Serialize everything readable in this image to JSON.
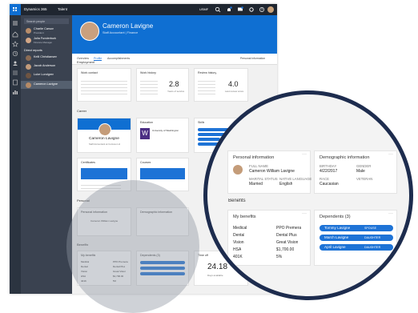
{
  "app": {
    "brand": "Dynamics 365",
    "module": "Talent",
    "company": "USMF",
    "topbar_icons": [
      "search-icon",
      "bell-icon",
      "chat-icon",
      "gear-icon",
      "help-icon"
    ]
  },
  "nav": {
    "search_placeholder": "Search people",
    "people": [
      {
        "name": "Charlie Carson",
        "title": "President"
      },
      {
        "name": "Julia Funderburk",
        "title": "Finance Manager"
      }
    ],
    "direct_reports_label": "Direct reports",
    "reports": [
      {
        "name": "Kelli Christiansen"
      },
      {
        "name": "Jacob Anderson"
      },
      {
        "name": "Luke Lundgren"
      },
      {
        "name": "Cameron Lavigne"
      }
    ]
  },
  "profile": {
    "name": "Cameron Lavigne",
    "subtitle": "Staff Accountant | Finance",
    "tabs": [
      "Overview",
      "Profile",
      "Accomplishments"
    ],
    "personal_info_link": "Personal information"
  },
  "employment": {
    "section": "Employment",
    "work_contact": {
      "title": "Work contact"
    },
    "work_history": {
      "title": "Work history",
      "years": "2.8",
      "caption": "Years of service"
    },
    "review_history": {
      "title": "Review history",
      "rating": "4.0",
      "caption": "Last review score"
    }
  },
  "career": {
    "section": "Career",
    "name": "Cameron Lavigne",
    "subtitle": "Staff Accountant at Contoso Ltd",
    "education": {
      "title": "Education",
      "school": "University of Washington"
    },
    "skills": {
      "title": "Skills"
    },
    "certificates": {
      "title": "Certificates"
    },
    "courses": {
      "title": "Courses"
    }
  },
  "personal": {
    "section": "Personal",
    "personal_information": {
      "title": "Personal information",
      "full_name_label": "FULL NAME",
      "full_name": "Cameron William Lavigne",
      "marital_label": "MARITAL STATUS",
      "marital": "Married",
      "language_label": "NATIVE LANGUAGE",
      "language": "English"
    },
    "demographic_information": {
      "title": "Demographic information",
      "birthday_label": "BIRTHDAY",
      "birthday": "4/22/2017",
      "gender_label": "GENDER",
      "gender": "Male",
      "race_label": "RACE",
      "race": "Caucasian",
      "veteran_label": "VETERAN"
    }
  },
  "benefits": {
    "section": "Benefits",
    "my_benefits": {
      "title": "My benefits",
      "rows": [
        {
          "label": "Medical",
          "value": "PPO Premera"
        },
        {
          "label": "Dental",
          "value": "Dental Plus"
        },
        {
          "label": "Vision",
          "value": "Great Vision"
        },
        {
          "label": "HSA",
          "value": "$1,700.00"
        },
        {
          "label": "401K",
          "value": "5%"
        }
      ]
    },
    "dependents": {
      "title": "Dependents (3)",
      "items": [
        {
          "name": "Tommy Lavigne",
          "relation": "SPOUSE"
        },
        {
          "name": "March Lavigne",
          "relation": "DAUGHTER"
        },
        {
          "name": "April Lavigne",
          "relation": "DAUGHTER"
        }
      ]
    },
    "time_off": {
      "title": "Time off",
      "value": "24.18",
      "caption": "Days available"
    }
  }
}
